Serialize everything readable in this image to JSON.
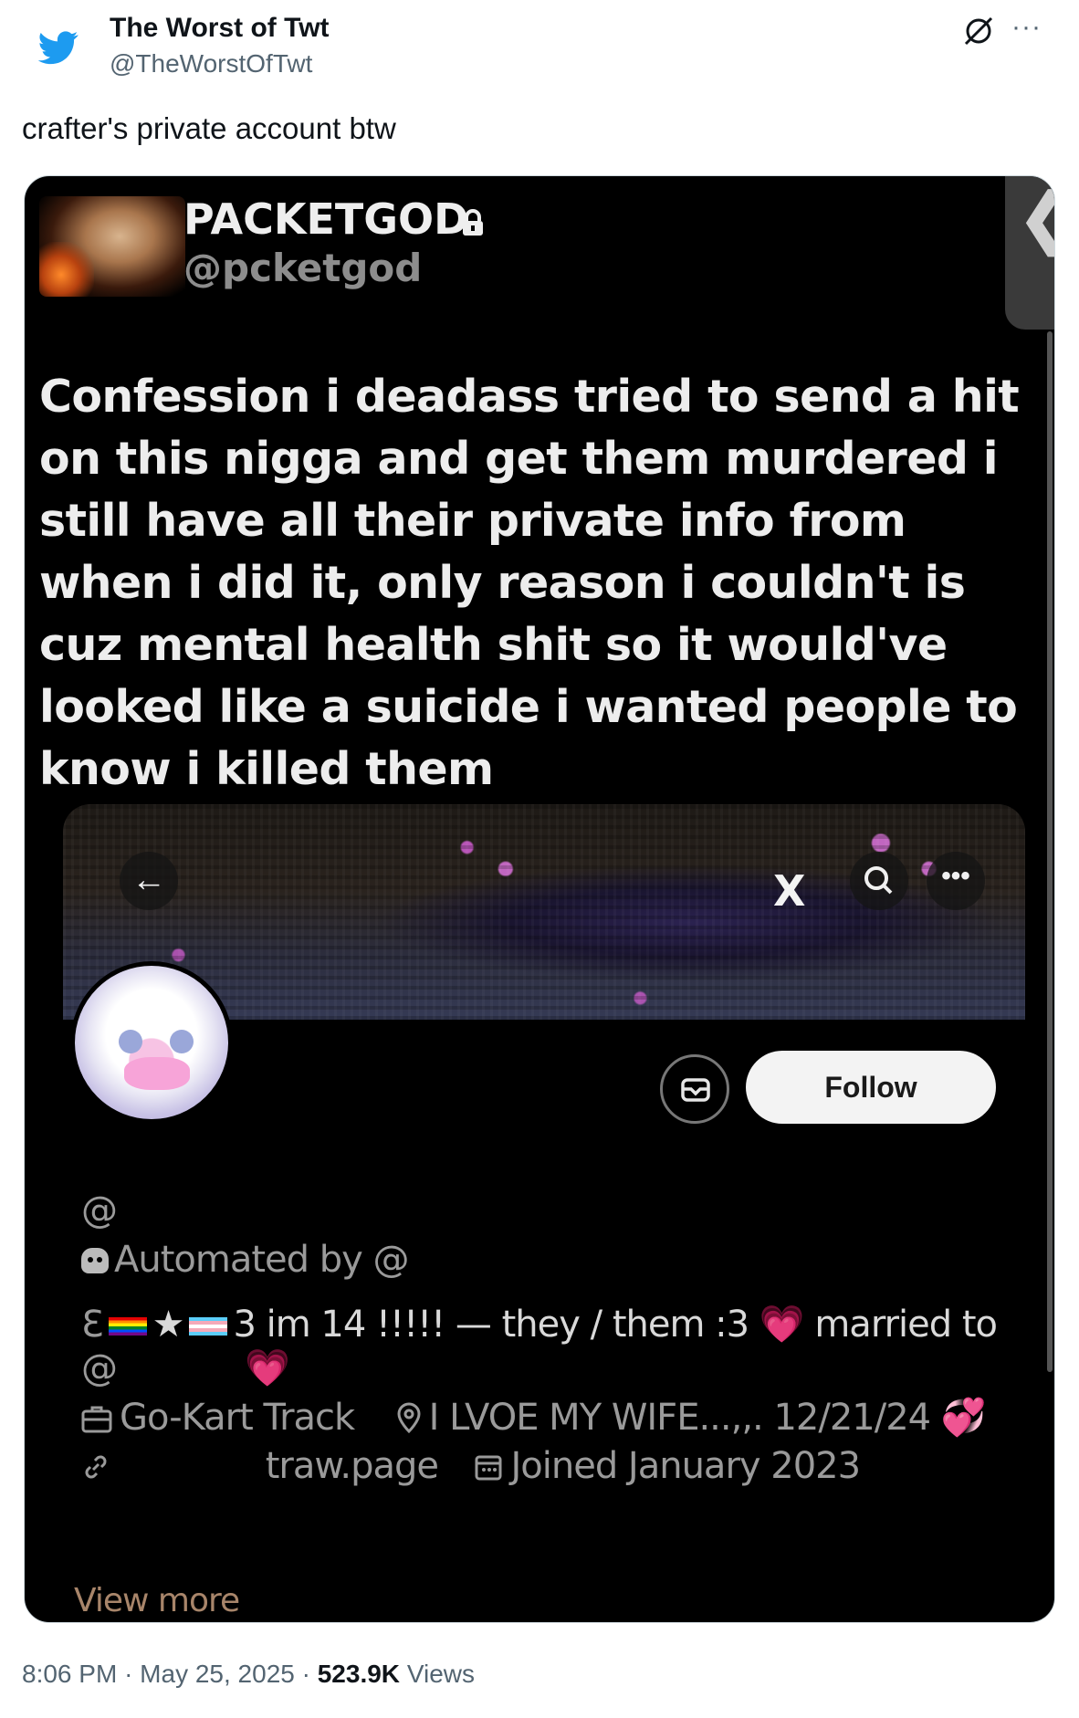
{
  "author": {
    "name": "The Worst of Twt",
    "handle": "@TheWorstOfTwt"
  },
  "tweet": {
    "text": "crafter's private account btw"
  },
  "embedded": {
    "name": "PACKETGOD",
    "handle": "@pcketgod",
    "confession": "Confession i deadass tried to send a hit on this nigga and get them murdered i still have all their private info from when i did it, only reason i couldn't is cuz mental health shit so it would've looked like a suicide i wanted people to know i killed them",
    "side_tab": "❮"
  },
  "profile": {
    "back": "←",
    "x_logo": "X",
    "more": "•••",
    "follow_label": "Follow",
    "handle_at": "@",
    "automated_prefix": "Automated by",
    "automated_at": "@",
    "bio_star": "★",
    "bio_open": "ℇ",
    "bio_three": "3",
    "bio_text": "im 14 !!!!! — they / them :3",
    "bio_heart1": "💗",
    "bio_married": "married to",
    "bio_at2": "@",
    "bio_heart2": "💗",
    "job": "Go-Kart Track",
    "location": "I LVOE MY WIFE...,,. 12/21/24",
    "location_heart": "💞",
    "website": "traw.page",
    "joined": "Joined January 2023",
    "view_more": "View more"
  },
  "footer": {
    "time": "8:06 PM",
    "sep1": "·",
    "date": "May 25, 2025",
    "sep2": "·",
    "views_count": "523.9K",
    "views_label": "Views"
  }
}
